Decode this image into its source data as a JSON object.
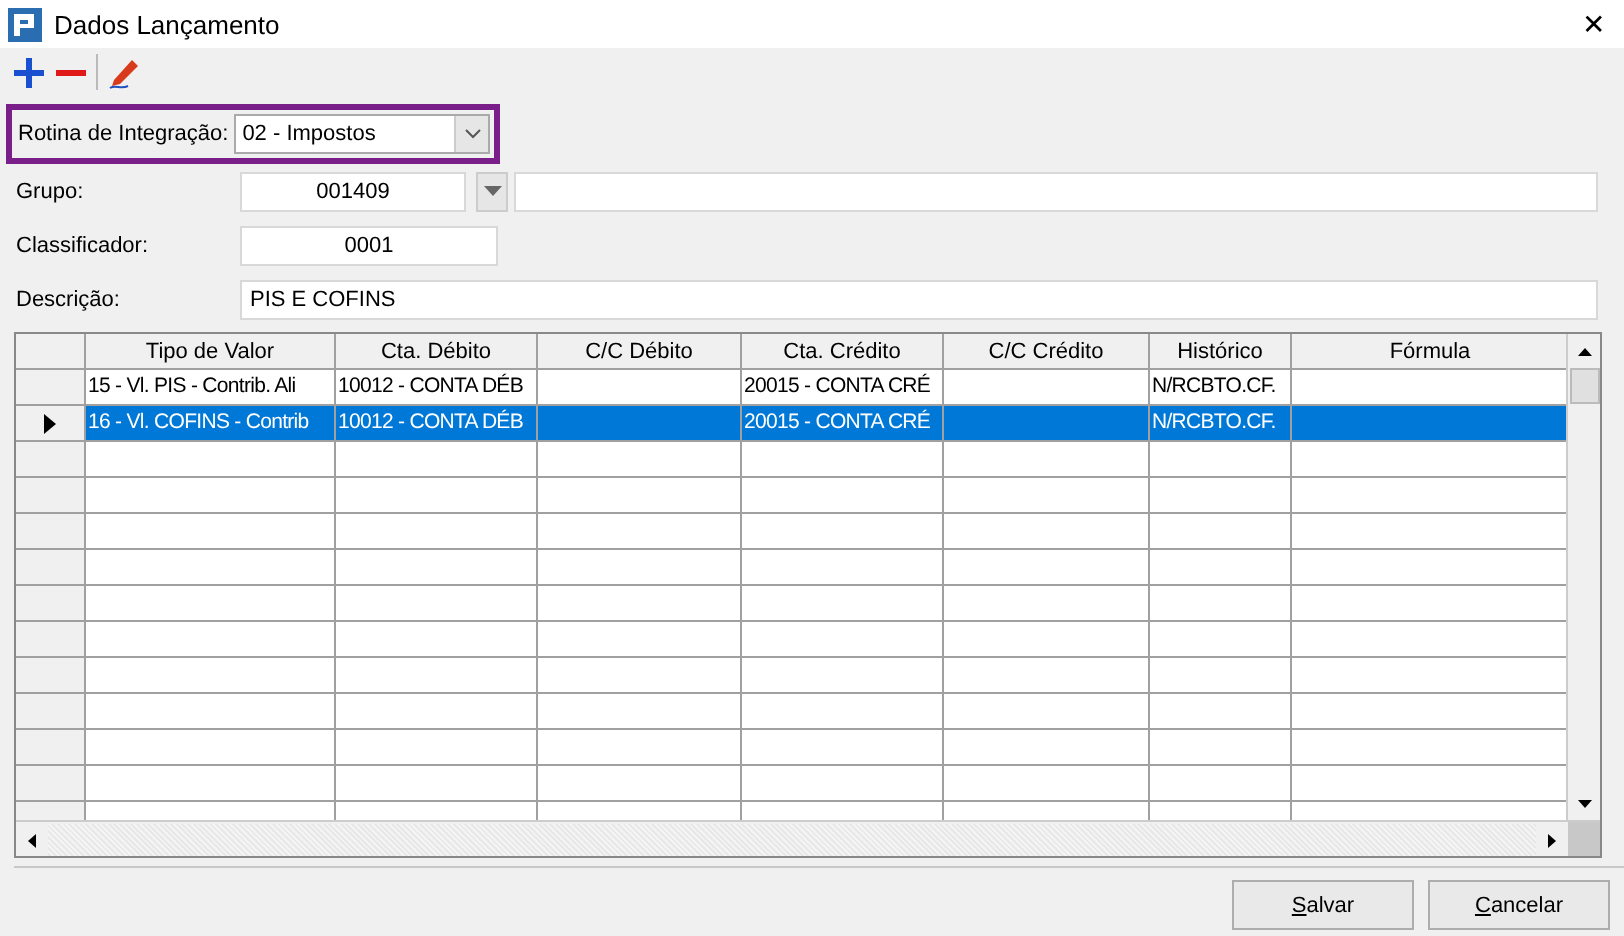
{
  "window": {
    "title": "Dados Lançamento",
    "close_glyph": "✕"
  },
  "toolbar": [
    {
      "kind": "add"
    },
    {
      "kind": "remove"
    },
    {
      "kind": "edit"
    }
  ],
  "form": {
    "rotina": {
      "label": "Rotina de Integração:",
      "value": "02 - Impostos"
    },
    "grupo": {
      "label": "Grupo:",
      "value": "001409"
    },
    "classificador": {
      "label": "Classificador:",
      "value": "0001"
    },
    "descricao": {
      "label": "Descrição:",
      "value": "PIS E COFINS"
    }
  },
  "table": {
    "columns": [
      "Tipo de Valor",
      "Cta. Débito",
      "C/C Débito",
      "Cta. Crédito",
      "C/C Crédito",
      "Histórico",
      "Fórmula"
    ],
    "rows": [
      {
        "selected": false,
        "cells": [
          "15 - Vl. PIS - Contrib. Ali",
          "10012 - CONTA DÉB",
          "",
          "20015 - CONTA CRÉ",
          "",
          "N/RCBTO.CF.",
          ""
        ]
      },
      {
        "selected": true,
        "cells": [
          "16 - Vl. COFINS - Contrib",
          "10012 - CONTA DÉB",
          "",
          "20015 - CONTA CRÉ",
          "",
          "N/RCBTO.CF.",
          ""
        ]
      }
    ]
  },
  "buttons": [
    {
      "label": "Salvar"
    },
    {
      "label": "Cancelar"
    }
  ]
}
